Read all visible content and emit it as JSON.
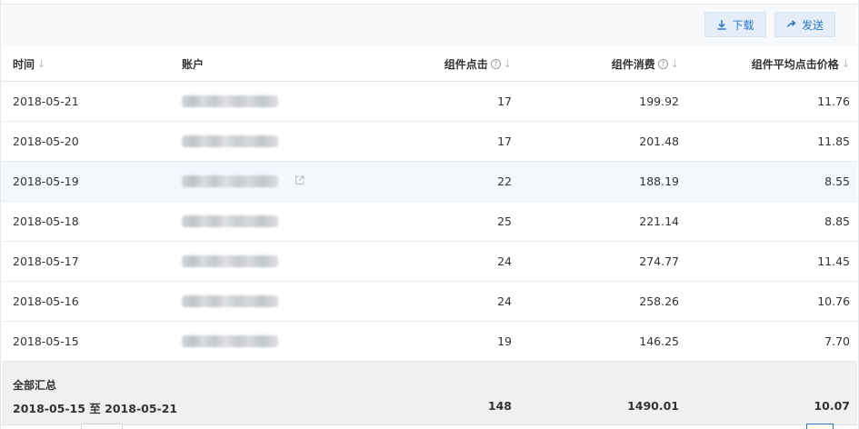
{
  "toolbar": {
    "download_label": "下载",
    "send_label": "发送",
    "accent": "#2a78c6"
  },
  "columns": {
    "date": "时间",
    "account": "账户",
    "clicks": "组件点击",
    "cost": "组件消费",
    "avg_price": "组件平均点击价格",
    "sort_glyph": "↓",
    "help_glyph": "?"
  },
  "rows": [
    {
      "date": "2018-05-21",
      "clicks": "17",
      "cost": "199.92",
      "avg_price": "11.76"
    },
    {
      "date": "2018-05-20",
      "clicks": "17",
      "cost": "201.48",
      "avg_price": "11.85"
    },
    {
      "date": "2018-05-19",
      "clicks": "22",
      "cost": "188.19",
      "avg_price": "8.55"
    },
    {
      "date": "2018-05-18",
      "clicks": "25",
      "cost": "221.14",
      "avg_price": "8.85"
    },
    {
      "date": "2018-05-17",
      "clicks": "24",
      "cost": "274.77",
      "avg_price": "11.45"
    },
    {
      "date": "2018-05-16",
      "clicks": "24",
      "cost": "258.26",
      "avg_price": "10.76"
    },
    {
      "date": "2018-05-15",
      "clicks": "19",
      "cost": "146.25",
      "avg_price": "7.70"
    }
  ],
  "summary": {
    "label": "全部汇总",
    "range": "2018-05-15 至 2018-05-21",
    "clicks": "148",
    "cost": "1490.01",
    "avg_price": "10.07"
  }
}
